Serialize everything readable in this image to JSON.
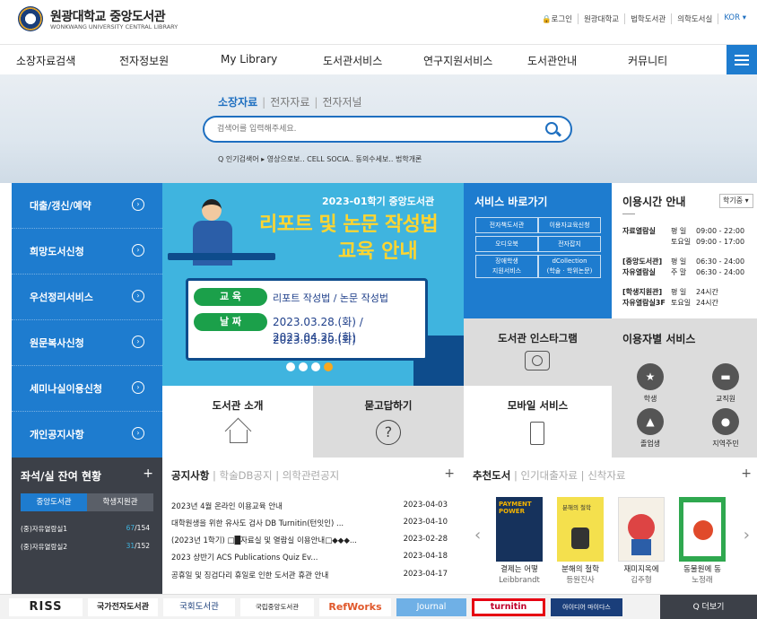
{
  "header": {
    "logo_title": "원광대학교 중앙도서관",
    "logo_sub": "WONKWANG UNIVERSITY CENTRAL LIBRARY",
    "utils": [
      "🔒로그인",
      "원광대학교",
      "법학도서관",
      "의학도서실",
      "KOR ▾"
    ]
  },
  "nav": {
    "items": [
      "소장자료검색",
      "전자정보원",
      "My Library",
      "도서관서비스",
      "연구지원서비스",
      "도서관안내",
      "커뮤니티"
    ]
  },
  "search": {
    "tabs": [
      "소장자료",
      "전자자료",
      "전자저널"
    ],
    "placeholder": "검색어를 입력해주세요.",
    "popular": "Q 인기검색어 ▸ 영상으로보.. CELL SOCIA.. 동의수세보.. 법학개론"
  },
  "left_menu": [
    "대출/갱신/예약",
    "희망도서신청",
    "우선정리서비스",
    "원문복사신청",
    "세미나실이용신청",
    "개인공지사항"
  ],
  "banner": {
    "term": "2023-01학기 중앙도서관",
    "headline1": "리포트 및 논문 작성법",
    "headline2": "교육 안내",
    "label_edu": "교 육",
    "edu_text": "리포트 작성법 / 논문 작성법",
    "label_date": "날 짜",
    "date_line1": "2023.03.28.(화) / 2023.04.25.(화)",
    "date_line2": "2023.05.30.(화)"
  },
  "services": {
    "title": "서비스 바로가기",
    "items": [
      "전자책도서관",
      "이용자교육신청",
      "오디오북",
      "전자잡지",
      "장애학생\n지원서비스",
      "dCollection\n(학술 · 학위논문)"
    ]
  },
  "hours": {
    "title": "이용시간 안내",
    "select": "학기중 ▾",
    "rows": [
      {
        "place": "자료열람실",
        "day": "평 일",
        "time": "09:00 - 22:00"
      },
      {
        "place": "",
        "day": "토요일",
        "time": "09:00 - 17:00"
      },
      {
        "place": "[중앙도서관]",
        "day": "평 일",
        "time": "06:30 - 24:00"
      },
      {
        "place": "자유열람실",
        "day": "주 말",
        "time": "06:30 - 24:00"
      },
      {
        "place": "[학생지원관]",
        "day": "평 일",
        "time": "24시간"
      },
      {
        "place": "자유열람실3F",
        "day": "토요일",
        "time": "24시간"
      }
    ]
  },
  "boxes": {
    "intro": "도서관 소개",
    "qna": "묻고답하기",
    "insta": "도서관 인스타그램",
    "mobile": "모바일 서비스"
  },
  "user_services": {
    "title": "이용자별 서비스",
    "items": [
      "학생",
      "교직원",
      "졸업생",
      "지역주민"
    ]
  },
  "seats": {
    "title": "좌석/실 잔여 현황",
    "plus": "+",
    "tabs": [
      "중앙도서관",
      "학생지원관"
    ],
    "rows": [
      {
        "name": "(중)자유열람실1",
        "avail": "67",
        "total": "/154"
      },
      {
        "name": "(중)자유열람실2",
        "avail": "31",
        "total": "/152"
      }
    ]
  },
  "notices": {
    "tabs": [
      "공지사항",
      "학술DB공지",
      "의학관련공지"
    ],
    "plus": "+",
    "items": [
      {
        "title": "2023년 4월 온라인 이용교육 안내",
        "date": "2023-04-03"
      },
      {
        "title": "대학원생을 위한 유사도 검사 DB Turnitin(턴잇인) ...",
        "date": "2023-04-10"
      },
      {
        "title": "(2023년 1학기) □█자료실 및 열람실 이용안내□◆◆◆...",
        "date": "2023-02-28"
      },
      {
        "title": "2023 상반기 ACS Publications Quiz Ev...",
        "date": "2023-04-18"
      },
      {
        "title": "공휴일 및 징검다리 휴일로 인한 도서관 휴관 안내",
        "date": "2023-04-17"
      }
    ]
  },
  "recommended": {
    "tabs": [
      "추천도서",
      "인기대출자료",
      "신착자료"
    ],
    "plus": "+",
    "books": [
      {
        "title": "결제는 어떻",
        "author": "Leibbrandt",
        "cover_text": "PAYMENT POWER",
        "color": "#16325c",
        "accent": "#f4b400"
      },
      {
        "title": "분해의 철학",
        "author": "등원진사",
        "cover_text": "분해의 철학",
        "color": "#f4e04d",
        "accent": "#333333"
      },
      {
        "title": "재미지옥에",
        "author": "김주형",
        "cover_text": "",
        "color": "#f5f0e6",
        "accent": "#d44"
      },
      {
        "title": "동물원에 동",
        "author": "노정래",
        "cover_text": "",
        "color": "#2fa84f",
        "accent": "#ffffff"
      }
    ]
  },
  "links": [
    "RISS",
    "국가전자도서관",
    "국회도서관",
    "국립중앙도서관",
    "RefWorks",
    "Journal",
    "turnitin",
    "아이디어 마이다스",
    "Q 더보기"
  ]
}
